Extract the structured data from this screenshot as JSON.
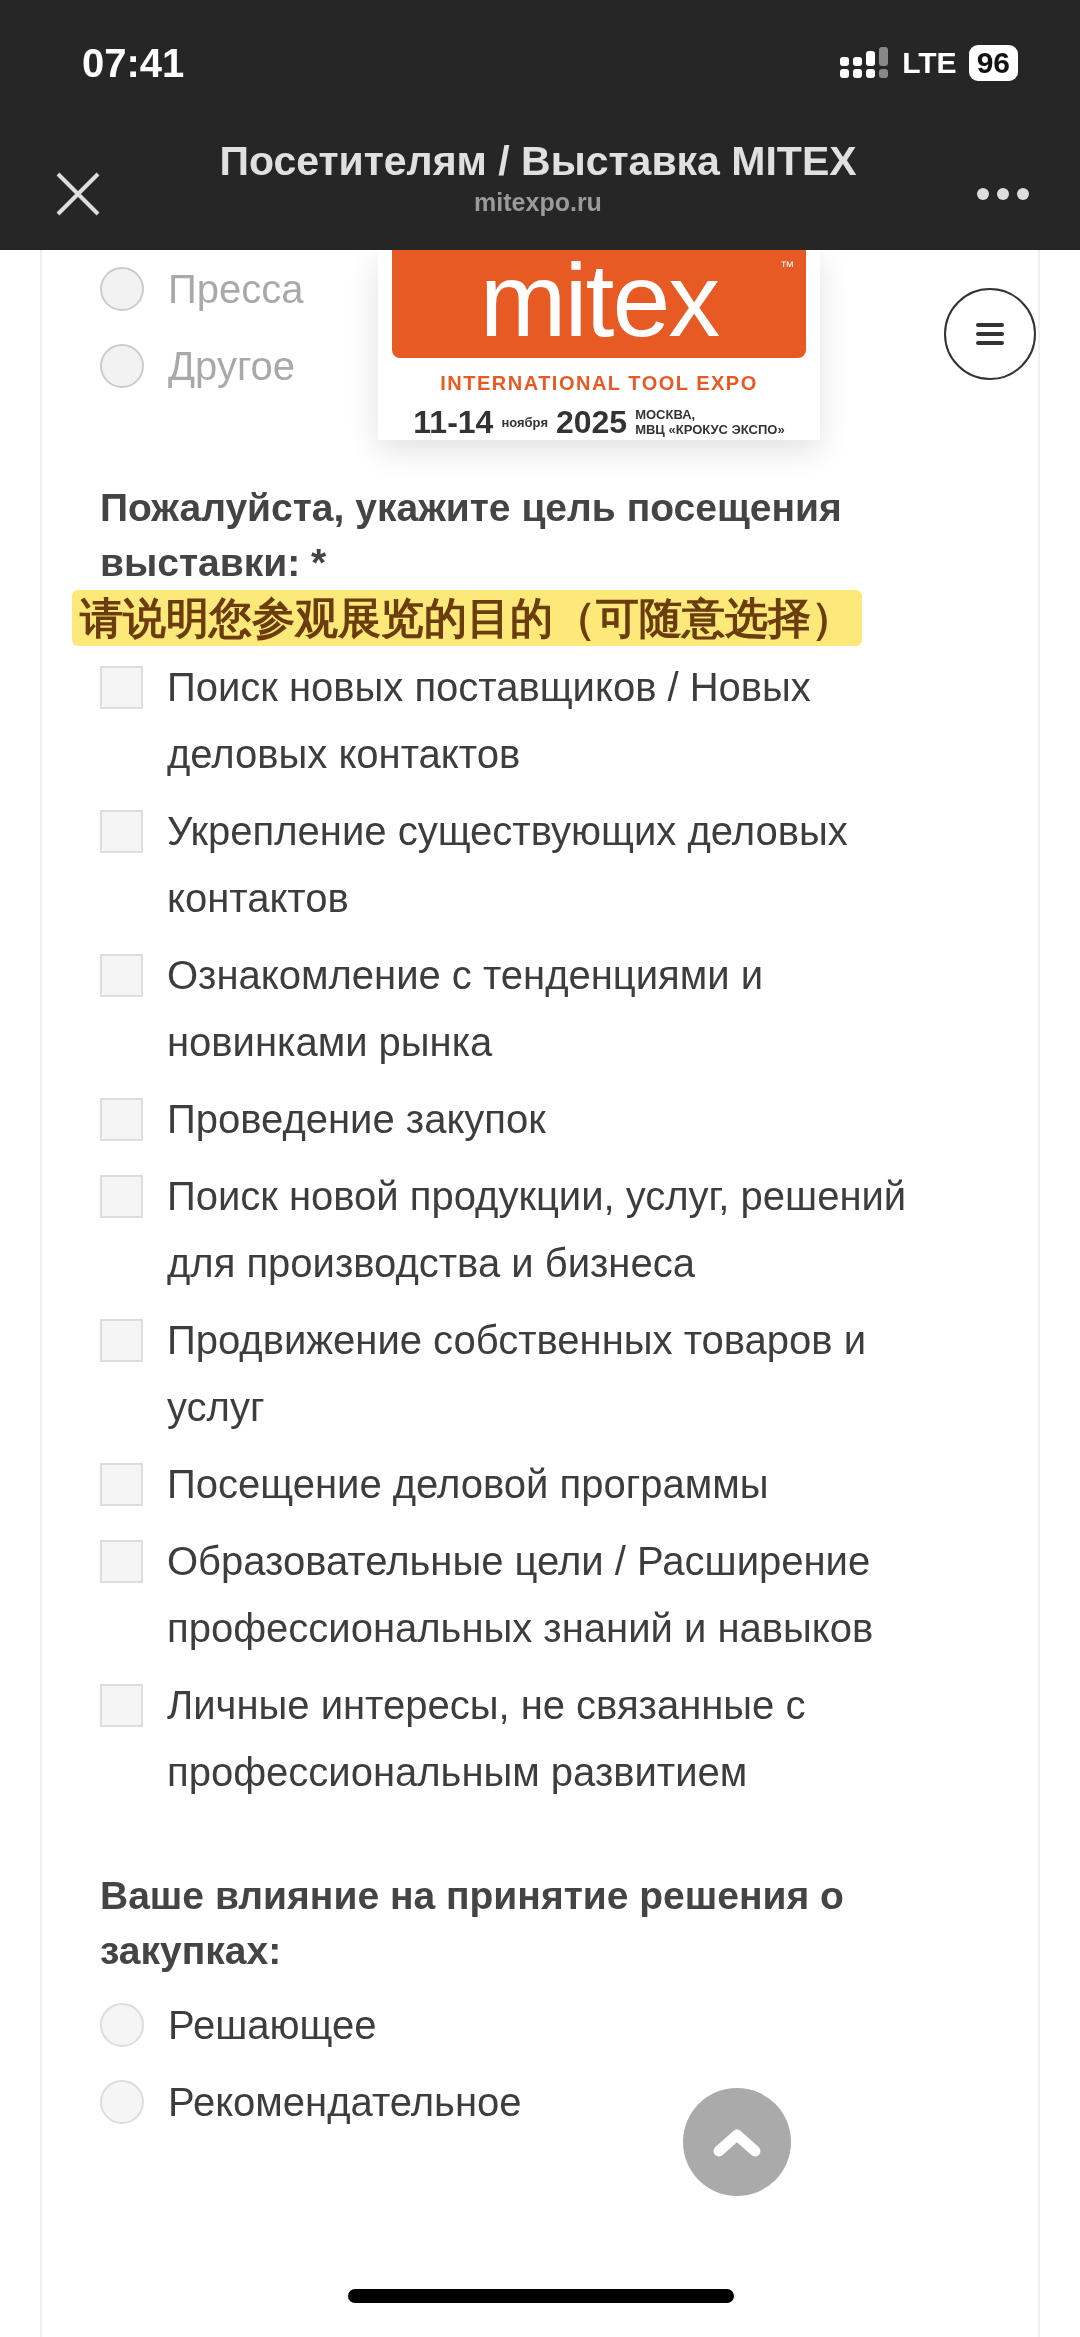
{
  "status_bar": {
    "time": "07:41",
    "network": "LTE",
    "battery": "96"
  },
  "header": {
    "title": "Посетителям / Выставка MITEX",
    "url": "mitexpo.ru"
  },
  "previous_options": [
    {
      "label": "Пресса",
      "selected": false
    },
    {
      "label": "Другое",
      "selected": false
    }
  ],
  "logo": {
    "brand": "mitex",
    "trademark": "™",
    "tagline": "INTERNATIONAL TOOL EXPO",
    "dates": "11-14",
    "month": "ноября",
    "year": "2025",
    "city": "МОСКВА,",
    "venue": "МВЦ «КРОКУС ЭКСПО»"
  },
  "questions": [
    {
      "kind": "checkbox",
      "title": "Пожалуйста, укажите цель посещения выставки: *",
      "note": "请说明您参观展览的目的（可随意选择）",
      "options": [
        {
          "label": "Поиск новых поставщиков / Новых деловых контактов",
          "checked": false
        },
        {
          "label": "Укрепление существующих деловых контактов",
          "checked": false
        },
        {
          "label": "Ознакомление с тенденциями и новинками рынка",
          "checked": false
        },
        {
          "label": "Проведение закупок",
          "checked": false
        },
        {
          "label": "Поиск новой продукции, услуг, решений для производства и бизнеса",
          "checked": false
        },
        {
          "label": "Продвижение собственных товаров и услуг",
          "checked": false
        },
        {
          "label": "Посещение деловой программы",
          "checked": false
        },
        {
          "label": "Образовательные цели / Расширение профессиональных знаний и навыков",
          "checked": false
        },
        {
          "label": "Личные интересы, не связанные с профессиональным развитием",
          "checked": false
        }
      ]
    },
    {
      "kind": "radio",
      "title": "Ваше влияние на принятие решения о закупках:",
      "options": [
        {
          "label": "Решающее",
          "selected": false
        },
        {
          "label": "Рекомендательное",
          "selected": false
        }
      ]
    }
  ]
}
